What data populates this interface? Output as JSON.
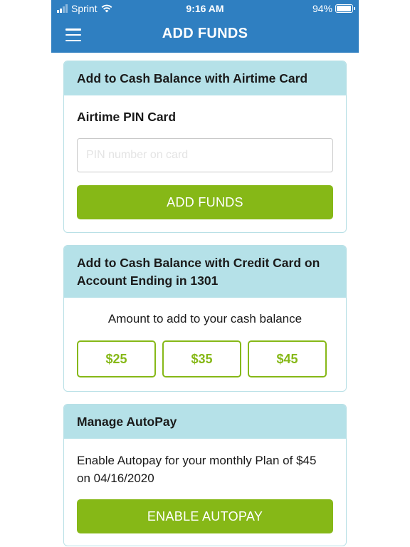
{
  "status_bar": {
    "carrier": "Sprint",
    "time": "9:16 AM",
    "battery": "94%",
    "battery_level": 0.94
  },
  "header": {
    "title": "ADD FUNDS",
    "menu_icon": "hamburger-menu-icon"
  },
  "airtime_card": {
    "heading": "Add to Cash Balance with Airtime Card",
    "pin_label": "Airtime PIN Card",
    "pin_placeholder": "PIN number on card",
    "pin_value": "",
    "button_label": "ADD FUNDS"
  },
  "credit_card": {
    "heading": "Add to Cash Balance with Credit Card on Account Ending in 1301",
    "prompt": "Amount to add to your cash balance",
    "amounts": [
      "$25",
      "$35",
      "$45"
    ]
  },
  "autopay": {
    "heading": "Manage AutoPay",
    "description": "Enable Autopay for your monthly Plan of $45 on 04/16/2020",
    "button_label": "ENABLE AUTOPAY"
  },
  "colors": {
    "header_bg": "#2f7fc1",
    "card_header_bg": "#b5e1e8",
    "accent_green": "#86b817"
  }
}
